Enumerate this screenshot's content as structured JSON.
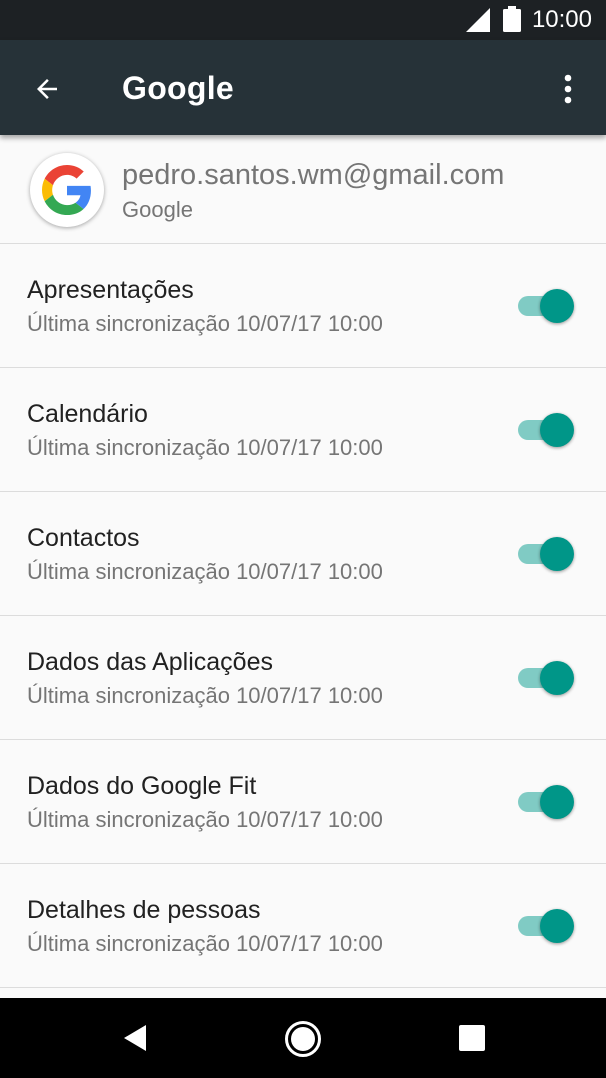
{
  "status_bar": {
    "time": "10:00",
    "signal_icon": "signal-icon",
    "battery_icon": "battery-icon"
  },
  "app_bar": {
    "title": "Google",
    "back_icon": "arrow-back-icon",
    "overflow_icon": "more-vert-icon",
    "background": "#263238"
  },
  "account": {
    "email": "pedro.santos.wm@gmail.com",
    "type": "Google",
    "avatar_icon": "google-logo-icon"
  },
  "sync_items": [
    {
      "title": "Apresentações",
      "subtitle": "Última sincronização 10/07/17 10:00",
      "enabled": true
    },
    {
      "title": "Calendário",
      "subtitle": "Última sincronização 10/07/17 10:00",
      "enabled": true
    },
    {
      "title": "Contactos",
      "subtitle": "Última sincronização 10/07/17 10:00",
      "enabled": true
    },
    {
      "title": "Dados das Aplicações",
      "subtitle": "Última sincronização 10/07/17 10:00",
      "enabled": true
    },
    {
      "title": "Dados do Google Fit",
      "subtitle": "Última sincronização 10/07/17 10:00",
      "enabled": true
    },
    {
      "title": "Detalhes de pessoas",
      "subtitle": "Última sincronização 10/07/17 10:00",
      "enabled": true
    }
  ],
  "colors": {
    "switch_on_thumb": "#009688",
    "switch_on_track": "#80cbc4"
  },
  "nav_bar": {
    "back_icon": "nav-back-icon",
    "home_icon": "nav-home-icon",
    "recents_icon": "nav-recents-icon"
  }
}
